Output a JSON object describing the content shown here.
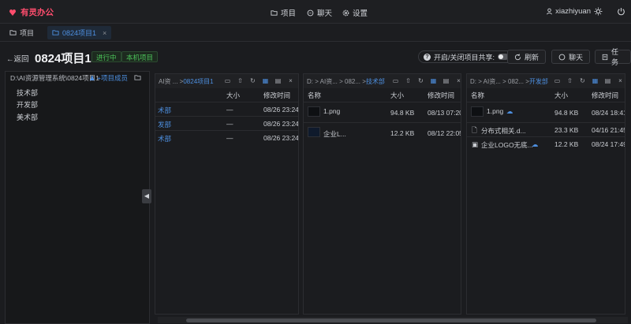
{
  "app": {
    "name": "有灵办公"
  },
  "nav": [
    {
      "label": "项目"
    },
    {
      "label": "聊天"
    },
    {
      "label": "设置"
    }
  ],
  "user": {
    "name": "xiazhiyuan"
  },
  "tabs": [
    {
      "label": "项目"
    },
    {
      "label": "0824项目1"
    }
  ],
  "header": {
    "back": "←返回",
    "title": "0824项目1",
    "badges": [
      "进行中",
      "本机项目"
    ],
    "share_label": "开启/关闭项目共享:",
    "buttons": [
      "刷新",
      "聊天",
      "任务"
    ]
  },
  "sidebar": {
    "path": "D:\\AI资源管理系统\\0824项目1",
    "members": "+项目成员",
    "items": [
      "技术部",
      "开发部",
      "美术部"
    ]
  },
  "columns": {
    "name": "名称",
    "size": "大小",
    "modified": "修改时间"
  },
  "panel1": {
    "crumb_prefix": "AI资 ... > ",
    "crumb_current": "0824项目1",
    "rows": [
      {
        "name": "术部",
        "size": "—",
        "modified": "08/26 23:24"
      },
      {
        "name": "发部",
        "size": "—",
        "modified": "08/26 23:24"
      },
      {
        "name": "术部",
        "size": "—",
        "modified": "08/26 23:24"
      }
    ]
  },
  "panel2": {
    "crumb_prefix": "D: > AI资... > 082... > ",
    "crumb_current": "技术部",
    "rows": [
      {
        "name": "1.png",
        "size": "94.8 KB",
        "modified": "08/13 07:20"
      },
      {
        "name": "企业L...",
        "size": "12.2 KB",
        "modified": "08/12 22:05"
      }
    ]
  },
  "panel3": {
    "crumb_prefix": "D: > AI资... > 082... > ",
    "crumb_current": "开发部",
    "rows": [
      {
        "name": "1.png",
        "size": "94.8 KB",
        "modified": "08/24 18:41"
      },
      {
        "name": "分布式相关.d...",
        "size": "23.3 KB",
        "modified": "04/16 21:45"
      },
      {
        "name": "企业LOGO无底...",
        "size": "12.2 KB",
        "modified": "08/24 17:49"
      }
    ]
  },
  "colors": {
    "accent": "#4d8fe0",
    "brand": "#ff4d6d",
    "success": "#4cc35a",
    "background": "#1b1c1f"
  }
}
